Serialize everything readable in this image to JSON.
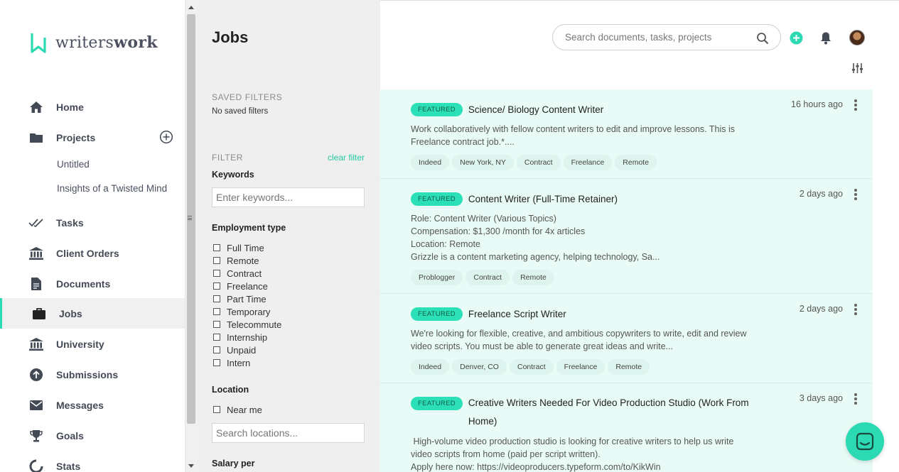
{
  "brand": {
    "name_light": "writers",
    "name_bold": "work"
  },
  "nav": {
    "home": "Home",
    "projects": "Projects",
    "project_items": [
      "Untitled",
      "Insights of a Twisted Mind"
    ],
    "tasks": "Tasks",
    "client_orders": "Client Orders",
    "documents": "Documents",
    "jobs": "Jobs",
    "university": "University",
    "submissions": "Submissions",
    "messages": "Messages",
    "goals": "Goals",
    "stats": "Stats"
  },
  "filters": {
    "page_title": "Jobs",
    "saved_filters_heading": "SAVED FILTERS",
    "saved_filters_empty": "No saved filters",
    "filter_heading": "FILTER",
    "clear_filter": "clear filter",
    "keywords_label": "Keywords",
    "keywords_placeholder": "Enter keywords...",
    "employment_type_label": "Employment type",
    "employment_types": [
      "Full Time",
      "Remote",
      "Contract",
      "Freelance",
      "Part Time",
      "Temporary",
      "Telecommute",
      "Internship",
      "Unpaid",
      "Intern"
    ],
    "location_label": "Location",
    "near_me": "Near me",
    "location_placeholder": "Search locations...",
    "salary_label": "Salary per"
  },
  "header": {
    "search_placeholder": "Search documents, tasks, projects",
    "accent_color": "#2bd9b2"
  },
  "jobs": [
    {
      "badge": "FEATURED",
      "title": "Science/ Biology Content Writer",
      "time": "16 hours ago",
      "desc": [
        "Work collaboratively with fellow content writers to edit and improve lessons. This is",
        "Freelance contract job.*...."
      ],
      "tags": [
        "Indeed",
        "New York, NY",
        "Contract",
        "Freelance",
        "Remote"
      ]
    },
    {
      "badge": "FEATURED",
      "title": "Content Writer (Full-Time Retainer)",
      "time": "2 days ago",
      "desc": [
        "Role: Content Writer (Various Topics)",
        "Compensation: $1,300 /month for 4x articles",
        "Location: Remote",
        "Grizzle is a content marketing agency, helping technology, Sa..."
      ],
      "tags": [
        "Problogger",
        "Contract",
        "Remote"
      ]
    },
    {
      "badge": "FEATURED",
      "title": "Freelance Script Writer",
      "time": "2 days ago",
      "desc": [
        "We're looking for flexible, creative, and ambitious copywriters to write, edit and review",
        "video scripts. You must be able to generate great ideas and write..."
      ],
      "tags": [
        "Indeed",
        "Denver, CO",
        "Contract",
        "Freelance",
        "Remote"
      ]
    },
    {
      "badge": "FEATURED",
      "title": "Creative Writers Needed For Video Production Studio (Work From Home)",
      "time": "3 days ago",
      "desc": [
        " High-volume video production studio is looking for creative writers to help us write",
        "video scripts from home (paid per script written).",
        "Apply here now: https://videoproducers.typeform.com/to/KikWin"
      ],
      "tags": []
    }
  ]
}
